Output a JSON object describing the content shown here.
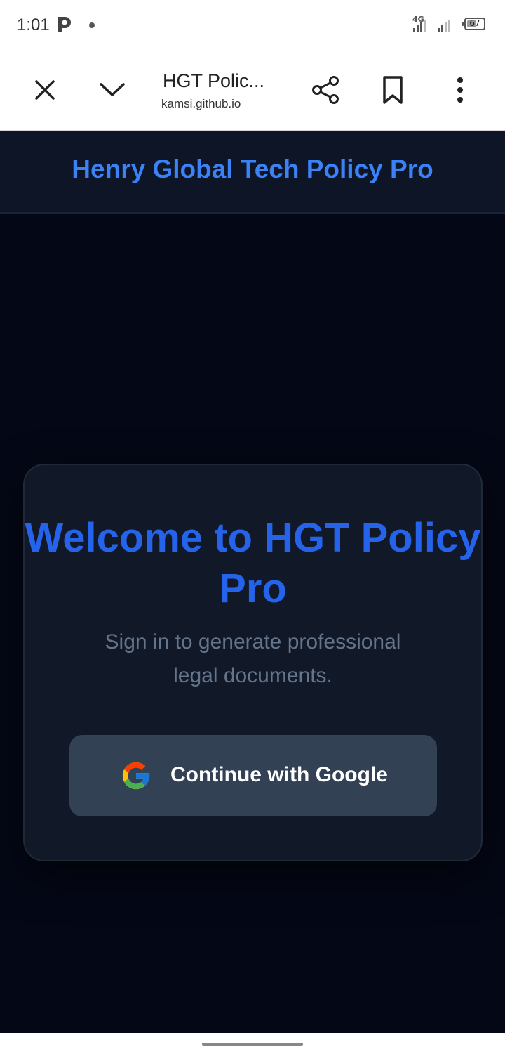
{
  "status_bar": {
    "time": "1:01",
    "network": "4G",
    "battery": "67",
    "battery_level_percent": 67
  },
  "browser": {
    "tab_title": "HGT Polic...",
    "url": "kamsi.github.io",
    "icons": [
      "close-icon",
      "chevron-down-icon",
      "share-icon",
      "bookmark-icon",
      "more-vert-icon"
    ]
  },
  "app": {
    "title": "Henry Global Tech Policy Pro"
  },
  "login_card": {
    "heading": "Welcome to HGT Policy Pro",
    "subtitle": "Sign in to generate professional legal documents.",
    "google_button_label": "Continue with Google"
  },
  "colors": {
    "accent": "#3b82f6",
    "heading": "#2563eb",
    "background": "#040816",
    "card": "#111827",
    "button": "#334155"
  }
}
